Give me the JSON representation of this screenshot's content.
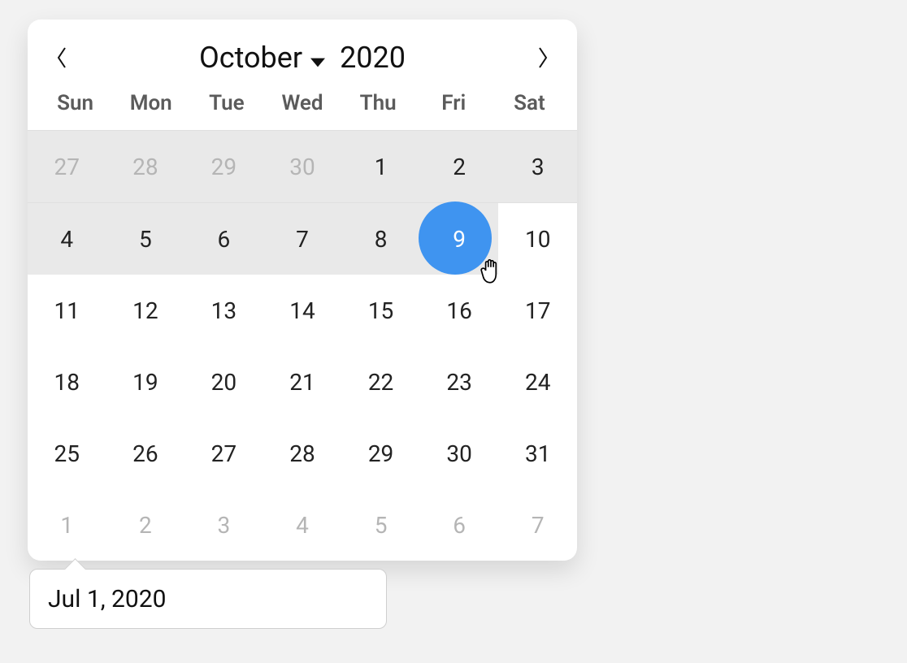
{
  "header": {
    "month_label": "October",
    "year_label": "2020"
  },
  "weekdays": [
    "Sun",
    "Mon",
    "Tue",
    "Wed",
    "Thu",
    "Fri",
    "Sat"
  ],
  "grid": [
    [
      {
        "n": "27",
        "other": true
      },
      {
        "n": "28",
        "other": true
      },
      {
        "n": "29",
        "other": true
      },
      {
        "n": "30",
        "other": true
      },
      {
        "n": "1"
      },
      {
        "n": "2"
      },
      {
        "n": "3"
      }
    ],
    [
      {
        "n": "4"
      },
      {
        "n": "5"
      },
      {
        "n": "6"
      },
      {
        "n": "7"
      },
      {
        "n": "8"
      },
      {
        "n": "9",
        "selected": true
      },
      {
        "n": "10",
        "after": true
      }
    ],
    [
      {
        "n": "11"
      },
      {
        "n": "12"
      },
      {
        "n": "13"
      },
      {
        "n": "14"
      },
      {
        "n": "15"
      },
      {
        "n": "16"
      },
      {
        "n": "17"
      }
    ],
    [
      {
        "n": "18"
      },
      {
        "n": "19"
      },
      {
        "n": "20"
      },
      {
        "n": "21"
      },
      {
        "n": "22"
      },
      {
        "n": "23"
      },
      {
        "n": "24"
      }
    ],
    [
      {
        "n": "25"
      },
      {
        "n": "26"
      },
      {
        "n": "27"
      },
      {
        "n": "28"
      },
      {
        "n": "29"
      },
      {
        "n": "30"
      },
      {
        "n": "31"
      }
    ],
    [
      {
        "n": "1",
        "other": true
      },
      {
        "n": "2",
        "other": true
      },
      {
        "n": "3",
        "other": true
      },
      {
        "n": "4",
        "other": true
      },
      {
        "n": "5",
        "other": true
      },
      {
        "n": "6",
        "other": true
      },
      {
        "n": "7",
        "other": true
      }
    ]
  ],
  "input": {
    "value": "Jul 1, 2020"
  },
  "colors": {
    "accent": "#3f94f0",
    "range_bg": "#e9e9e9"
  }
}
